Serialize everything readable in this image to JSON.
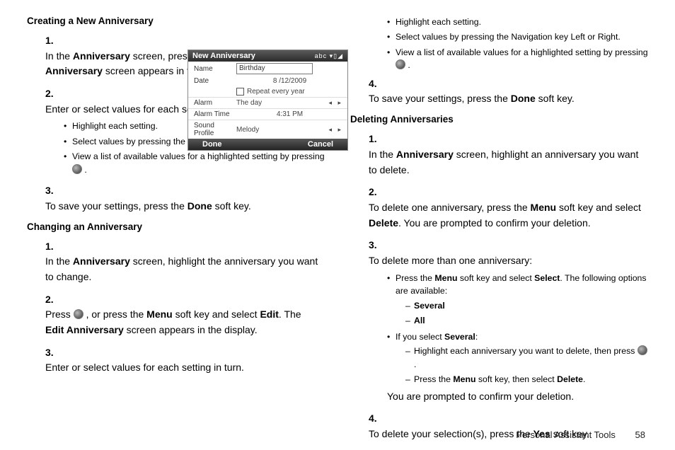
{
  "col1": {
    "section1_title": "Creating a New Anniversary",
    "s1_item1_text": "In the <b>Anniversary</b> screen, press the <b>New</b> soft key. The <b>New Anniversary</b> screen appears in the display.",
    "s1_item2_text": "Enter or select values for each setting in turn.",
    "s1_item2_bullets": [
      "Highlight each setting.",
      "Select values by pressing the Navigation key Left or Right.",
      "View a list of available values for a highlighted setting by pressing  {OK} ."
    ],
    "s1_item3_text": "To save your settings, press the <b>Done</b> soft key.",
    "section2_title": "Changing an Anniversary",
    "s2_item1_text": "In the <b>Anniversary</b> screen, highlight the anniversary you want to change.",
    "s2_item2_text": "Press  {OK} , or press the <b>Menu</b> soft key and select <b>Edit</b>. The <b>Edit Anniversary</b> screen appears in the display.",
    "s2_item3_text": "Enter or select values for each setting in turn."
  },
  "col2": {
    "pre_bullets": [
      "Highlight each setting.",
      "Select values by pressing the Navigation key Left or Right.",
      "View a list of available values for a highlighted setting by pressing {OK} ."
    ],
    "pre_item4_text": "To save your settings, press the <b>Done</b> soft key.",
    "section3_title": "Deleting Anniversaries",
    "s3_item1_text": "In the <b>Anniversary</b> screen, highlight an anniversary you want to delete.",
    "s3_item2_text": "To delete one anniversary, press the <b>Menu</b> soft key and select <b>Delete</b>. You are prompted to confirm your deletion.",
    "s3_item3_text": "To delete more than one anniversary:",
    "s3_item3_bul1": "Press the <b>Menu</b> soft key and select <b>Select</b>. The following options are available:",
    "s3_item3_dash1": "Several",
    "s3_item3_dash2": "All",
    "s3_item3_bul2": "If you select <b>Several</b>:",
    "s3_item3_dash3": "Highlight each anniversary you want to delete, then press  {OK} .",
    "s3_item3_dash4": "Press the <b>Menu</b> soft key, then select <b>Delete</b>.",
    "s3_item3_tail": "You are prompted to confirm your deletion.",
    "s3_item4_text": "To delete your selection(s), press the <b>Yes</b> soft key."
  },
  "phone": {
    "title": "New Anniversary",
    "status": "abc ▾▯◢",
    "name_label": "Name",
    "name_value": "Birthday",
    "date_label": "Date",
    "date_value": "8 /12/2009",
    "repeat_label": "Repeat every year",
    "alarm_label": "Alarm",
    "alarm_value": "The day",
    "alarmtime_label": "Alarm Time",
    "alarmtime_value": "4:31 PM",
    "sound_label": "Sound Profile",
    "sound_value": "Melody",
    "done": "Done",
    "cancel": "Cancel"
  },
  "footer": {
    "section": "Personal Assistant Tools",
    "page": "58"
  }
}
